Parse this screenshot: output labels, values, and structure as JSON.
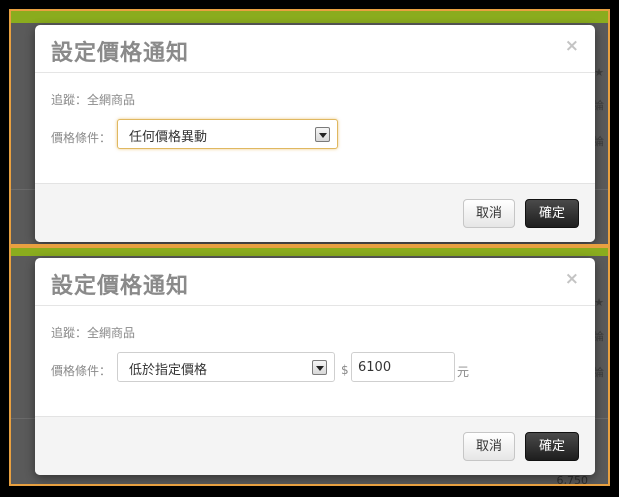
{
  "panels": [
    {
      "dialog": {
        "title": "設定價格通知",
        "close_glyph": "×",
        "tracking_text": "追蹤：全網商品",
        "condition_label": "價格條件：",
        "condition_selected": "任何價格異動",
        "cancel_label": "取消",
        "confirm_label": "確定"
      },
      "background": {
        "text_a": "★",
        "text_b": "論",
        "text_c": "論"
      }
    },
    {
      "dialog": {
        "title": "設定價格通知",
        "close_glyph": "×",
        "tracking_text": "追蹤：全網商品",
        "condition_label": "價格條件：",
        "condition_selected": "低於指定價格",
        "currency_symbol": "$",
        "price_value": "6100",
        "unit_label": "元",
        "cancel_label": "取消",
        "confirm_label": "確定"
      },
      "background": {
        "text_a": "★",
        "text_b": "論",
        "text_c": "論",
        "text_d": "6,750"
      }
    }
  ],
  "colors": {
    "frame_border": "#e8a040",
    "top_bar": "#8aac1e",
    "confirm_button": "#1e1e1e"
  }
}
